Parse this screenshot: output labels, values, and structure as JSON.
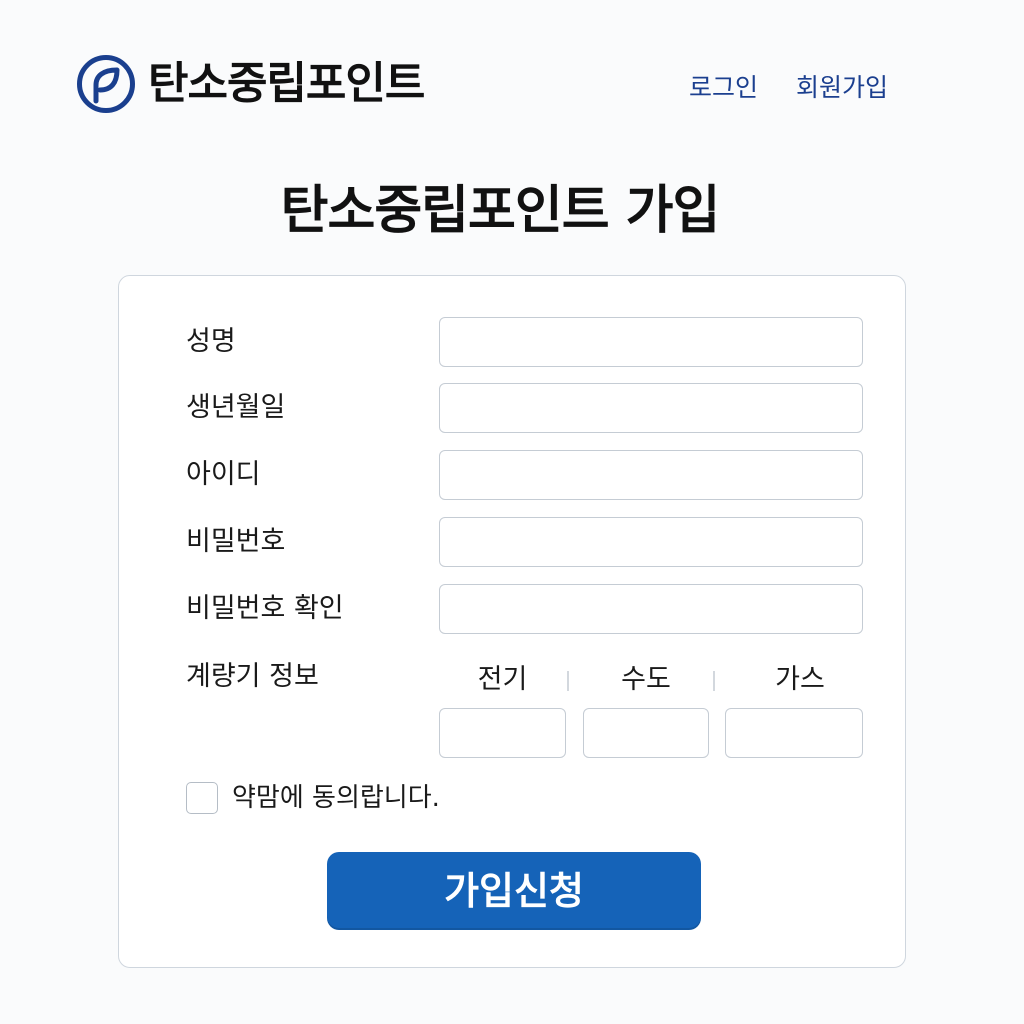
{
  "brand": {
    "name": "탄소중립포인트",
    "logo_icon": "leaf-circle-icon",
    "accent": "#1b3f8f"
  },
  "nav": {
    "login": "로그인",
    "signup": "회원가입"
  },
  "page": {
    "title": "탄소중립포인트 가입"
  },
  "form": {
    "fields": [
      {
        "label": "성명",
        "value": "",
        "placeholder": ""
      },
      {
        "label": "생년월일",
        "value": "",
        "placeholder": ""
      },
      {
        "label": "아이디",
        "value": "",
        "placeholder": ""
      },
      {
        "label": "비밀번호",
        "value": "",
        "placeholder": ""
      },
      {
        "label": "비밀번호 확인",
        "value": "",
        "placeholder": ""
      }
    ],
    "meter": {
      "label": "계량기 정보",
      "columns": [
        {
          "label": "전기",
          "value": ""
        },
        {
          "label": "수도",
          "value": ""
        },
        {
          "label": "가스",
          "value": ""
        }
      ]
    },
    "agree_text": "약맘에 동의랍니다.",
    "agree_checked": false,
    "submit_label": "가입신청",
    "submit_color": "#1563b8"
  }
}
